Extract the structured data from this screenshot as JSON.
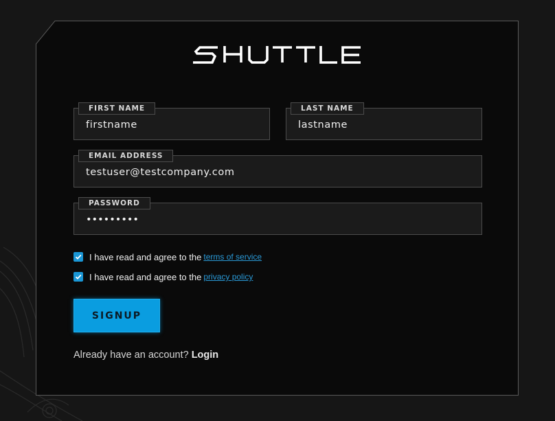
{
  "brand": {
    "name": "SHUTTLE",
    "accent_color": "#0a9de0",
    "link_color": "#2a9ad8"
  },
  "form": {
    "first_name": {
      "label": "FIRST NAME",
      "value": "firstname"
    },
    "last_name": {
      "label": "LAST NAME",
      "value": "lastname"
    },
    "email": {
      "label": "EMAIL ADDRESS",
      "value": "testuser@testcompany.com"
    },
    "password": {
      "label": "PASSWORD",
      "value": "•••••••••"
    }
  },
  "agreements": [
    {
      "prefix": "I have read and agree to the",
      "link_text": "terms of service",
      "checked": true
    },
    {
      "prefix": "I have read and agree to the",
      "link_text": "privacy policy",
      "checked": true
    }
  ],
  "signup_button": {
    "label": "SIGNUP"
  },
  "footer": {
    "prompt": "Already have an account?",
    "login_label": "Login"
  },
  "icons": {
    "checkbox": "checkmark-icon",
    "logo": "shuttle-logo"
  }
}
